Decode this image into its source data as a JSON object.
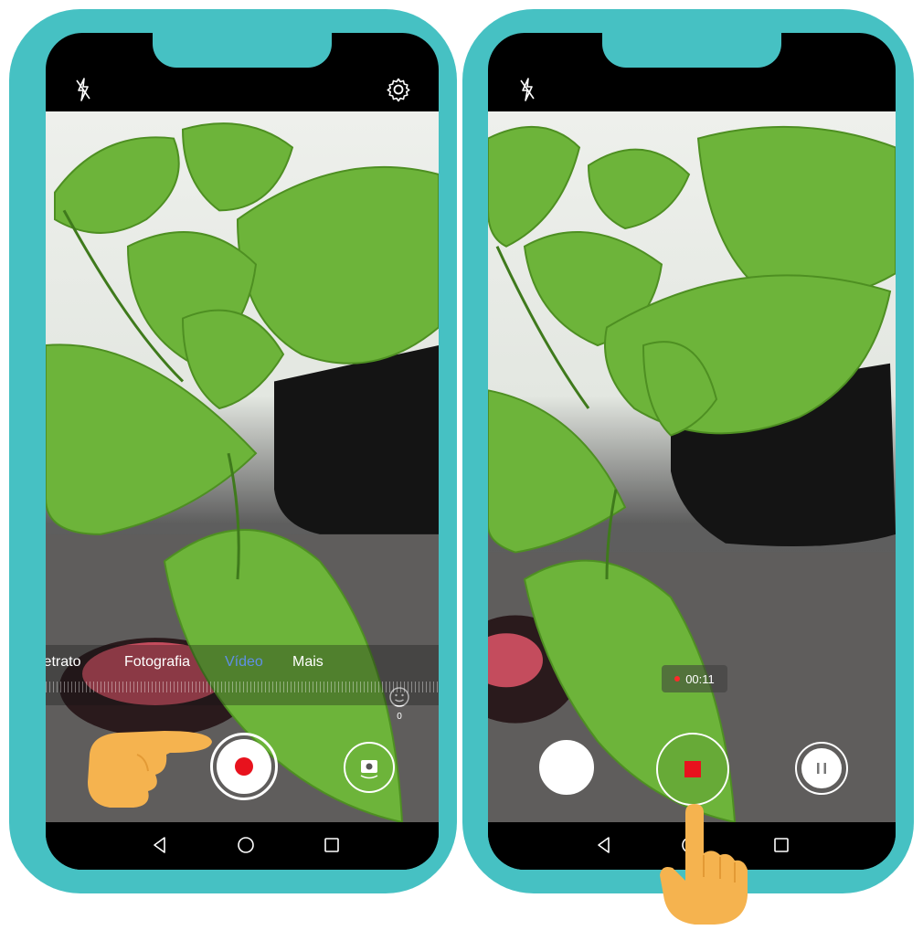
{
  "colors": {
    "frame": "#46c1c3",
    "record_red": "#e8121d",
    "active_mode": "#5f8fe6",
    "hand": "#f5b34f"
  },
  "left_phone": {
    "icons": {
      "flash": "flash-off-icon",
      "settings": "gear-icon",
      "beauty": "beauty-face-icon",
      "switch_camera": "switch-camera-icon"
    },
    "beauty_level": "0",
    "modes": [
      {
        "label": "Retrato",
        "active": false
      },
      {
        "label": "Fotografia",
        "active": false
      },
      {
        "label": "Vídeo",
        "active": true
      },
      {
        "label": "Mais",
        "active": false
      }
    ],
    "shutter_state": "ready-to-record"
  },
  "right_phone": {
    "icons": {
      "flash": "flash-off-icon",
      "pause": "pause-icon",
      "stop": "stop-icon"
    },
    "timer": "00:11",
    "shutter_state": "recording"
  },
  "nav": {
    "back": "back-triangle-icon",
    "home": "home-circle-icon",
    "recents": "recents-square-icon"
  },
  "hand_pointers": [
    "pointing-hand-right-icon",
    "pointing-hand-up-icon"
  ]
}
